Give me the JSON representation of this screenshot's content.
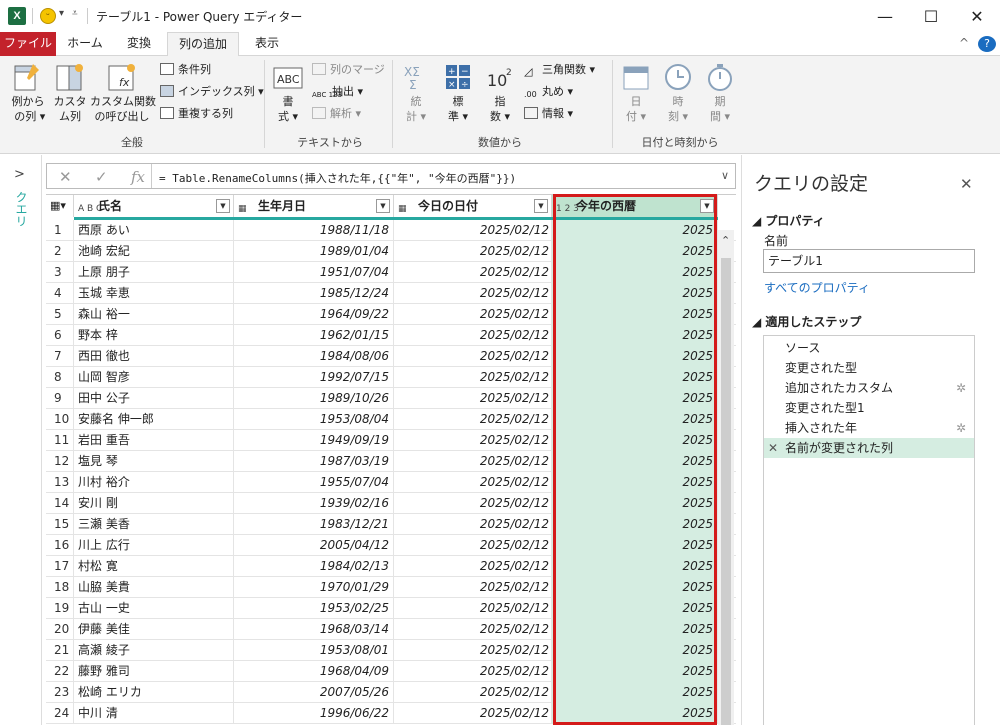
{
  "window": {
    "title": "テーブル1 - Power Query エディター",
    "minimize": "—",
    "maximize": "☐",
    "close": "✕"
  },
  "tabs": [
    "ファイル",
    "ホーム",
    "変換",
    "列の追加",
    "表示"
  ],
  "ribbon": {
    "example_col": "例から\n の列 ▾",
    "custom_col": "カスタ\nム列",
    "invoke_custom": "カスタム関数\nの呼び出し",
    "conditional_col": "条件列",
    "index_col": "インデックス列 ▾",
    "duplicate_col": "重複する列",
    "group_general": "全般",
    "format": "書\n式 ▾",
    "merge_cols": "列のマージ",
    "extract": "抽出 ▾",
    "parse": "解析 ▾",
    "group_text": "テキストから",
    "statistics": "統\n計 ▾",
    "standard": "標\n準 ▾",
    "scientific": "指\n数 ▾",
    "trig": "三角関数 ▾",
    "rounding": "丸め ▾",
    "information": "情報 ▾",
    "group_number": "数値から",
    "date": "日\n付 ▾",
    "time": "時\n刻 ▾",
    "duration": "期\n間 ▾",
    "group_datetime": "日付と時刻から",
    "collapse": "^",
    "help": "?"
  },
  "left_pane": {
    "label": "クエリ",
    "expand": ">"
  },
  "formula": {
    "cancel": "✕",
    "commit": "✓",
    "fx": "fx",
    "text": "= Table.RenameColumns(挿入された年,{{\"年\", \"今年の西暦\"}})",
    "expand": "∨"
  },
  "table": {
    "columns": [
      {
        "type_icon": "A B C",
        "label": "氏名"
      },
      {
        "type_icon": "▦",
        "label": "生年月日"
      },
      {
        "type_icon": "▦",
        "label": "今日の日付"
      },
      {
        "type_icon": "1 2 3",
        "label": "今年の西暦"
      }
    ],
    "rows": [
      {
        "n": "1",
        "name": "西原 あい",
        "birth": "1988/11/18",
        "today": "2025/02/12",
        "year": "2025"
      },
      {
        "n": "2",
        "name": "池崎 宏紀",
        "birth": "1989/01/04",
        "today": "2025/02/12",
        "year": "2025"
      },
      {
        "n": "3",
        "name": "上原 朋子",
        "birth": "1951/07/04",
        "today": "2025/02/12",
        "year": "2025"
      },
      {
        "n": "4",
        "name": "玉城 幸恵",
        "birth": "1985/12/24",
        "today": "2025/02/12",
        "year": "2025"
      },
      {
        "n": "5",
        "name": "森山 裕一",
        "birth": "1964/09/22",
        "today": "2025/02/12",
        "year": "2025"
      },
      {
        "n": "6",
        "name": "野本 梓",
        "birth": "1962/01/15",
        "today": "2025/02/12",
        "year": "2025"
      },
      {
        "n": "7",
        "name": "西田 徹也",
        "birth": "1984/08/06",
        "today": "2025/02/12",
        "year": "2025"
      },
      {
        "n": "8",
        "name": "山岡 智彦",
        "birth": "1992/07/15",
        "today": "2025/02/12",
        "year": "2025"
      },
      {
        "n": "9",
        "name": "田中 公子",
        "birth": "1989/10/26",
        "today": "2025/02/12",
        "year": "2025"
      },
      {
        "n": "10",
        "name": "安藤名 伸一郎",
        "birth": "1953/08/04",
        "today": "2025/02/12",
        "year": "2025"
      },
      {
        "n": "11",
        "name": "岩田 重吾",
        "birth": "1949/09/19",
        "today": "2025/02/12",
        "year": "2025"
      },
      {
        "n": "12",
        "name": "塩見 琴",
        "birth": "1987/03/19",
        "today": "2025/02/12",
        "year": "2025"
      },
      {
        "n": "13",
        "name": "川村 裕介",
        "birth": "1955/07/04",
        "today": "2025/02/12",
        "year": "2025"
      },
      {
        "n": "14",
        "name": "安川 剛",
        "birth": "1939/02/16",
        "today": "2025/02/12",
        "year": "2025"
      },
      {
        "n": "15",
        "name": "三瀬 美香",
        "birth": "1983/12/21",
        "today": "2025/02/12",
        "year": "2025"
      },
      {
        "n": "16",
        "name": "川上 広行",
        "birth": "2005/04/12",
        "today": "2025/02/12",
        "year": "2025"
      },
      {
        "n": "17",
        "name": "村松 寛",
        "birth": "1984/02/13",
        "today": "2025/02/12",
        "year": "2025"
      },
      {
        "n": "18",
        "name": "山脇 美貴",
        "birth": "1970/01/29",
        "today": "2025/02/12",
        "year": "2025"
      },
      {
        "n": "19",
        "name": "古山 一史",
        "birth": "1953/02/25",
        "today": "2025/02/12",
        "year": "2025"
      },
      {
        "n": "20",
        "name": "伊藤 美佳",
        "birth": "1968/03/14",
        "today": "2025/02/12",
        "year": "2025"
      },
      {
        "n": "21",
        "name": "高瀬 綾子",
        "birth": "1953/08/01",
        "today": "2025/02/12",
        "year": "2025"
      },
      {
        "n": "22",
        "name": "藤野 雅司",
        "birth": "1968/04/09",
        "today": "2025/02/12",
        "year": "2025"
      },
      {
        "n": "23",
        "name": "松崎 エリカ",
        "birth": "2007/05/26",
        "today": "2025/02/12",
        "year": "2025"
      },
      {
        "n": "24",
        "name": "中川 清",
        "birth": "1996/06/22",
        "today": "2025/02/12",
        "year": "2025"
      }
    ]
  },
  "settings": {
    "title": "クエリの設定",
    "close": "✕",
    "properties": "◢ プロパティ",
    "name_label": "名前",
    "name_value": "テーブル1",
    "all_props": "すべてのプロパティ",
    "applied_steps": "◢ 適用したステップ",
    "steps": [
      {
        "label": "ソース",
        "gear": ""
      },
      {
        "label": "変更された型",
        "gear": ""
      },
      {
        "label": "追加されたカスタム",
        "gear": "✲"
      },
      {
        "label": "変更された型1",
        "gear": ""
      },
      {
        "label": "挿入された年",
        "gear": "✲"
      },
      {
        "label": "名前が変更された列",
        "gear": ""
      }
    ],
    "step_delete": "✕"
  }
}
